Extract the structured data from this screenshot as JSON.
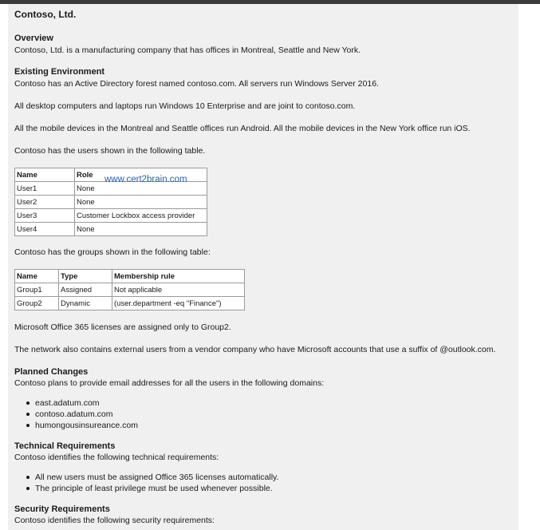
{
  "title": "Contoso, Ltd.",
  "overview": {
    "heading": "Overview",
    "text": "Contoso, Ltd. is a manufacturing company that has offices in Montreal, Seattle and New York."
  },
  "existing": {
    "heading": "Existing Environment",
    "p1": "Contoso has an Active Directory forest named contoso.com. All servers run Windows Server 2016.",
    "p2": "All desktop computers and laptops run Windows 10 Enterprise and are joint to contoso.com.",
    "p3": "All the mobile devices in the Montreal and Seattle offices run Android. All the mobile devices in the New York office run iOS.",
    "p4": "Contoso has the users shown in the following table."
  },
  "users_table": {
    "headers": [
      "Name",
      "Role"
    ],
    "rows": [
      [
        "User1",
        "None"
      ],
      [
        "User2",
        "None"
      ],
      [
        "User3",
        "Customer Lockbox access provider"
      ],
      [
        "User4",
        "None"
      ]
    ]
  },
  "watermark": "www.cert2brain.com",
  "groups_intro": "Contoso has the groups shown in the following table:",
  "groups_table": {
    "headers": [
      "Name",
      "Type",
      "Membership rule"
    ],
    "rows": [
      [
        "Group1",
        "Assigned",
        "Not applicable"
      ],
      [
        "Group2",
        "Dynamic",
        "(user.department -eq \"Finance\")"
      ]
    ]
  },
  "licenses_text": "Microsoft Office 365 licenses are assigned only to Group2.",
  "network_text": "The network also contains external users from a vendor company who have Microsoft accounts that use a suffix of @outlook.com.",
  "planned": {
    "heading": "Planned Changes",
    "text": "Contoso plans to provide email addresses for all the users in the following domains:",
    "items": [
      "east.adatum.com",
      "contoso.adatum.com",
      "humongousinsureance.com"
    ]
  },
  "technical": {
    "heading": "Technical Requirements",
    "text": "Contoso identifies the following technical requirements:",
    "items": [
      "All new users must be assigned Office 365 licenses automatically.",
      "The principle of least privilege must be used whenever possible."
    ]
  },
  "security": {
    "heading": "Security Requirements",
    "text": "Contoso identifies the following security requirements:"
  }
}
